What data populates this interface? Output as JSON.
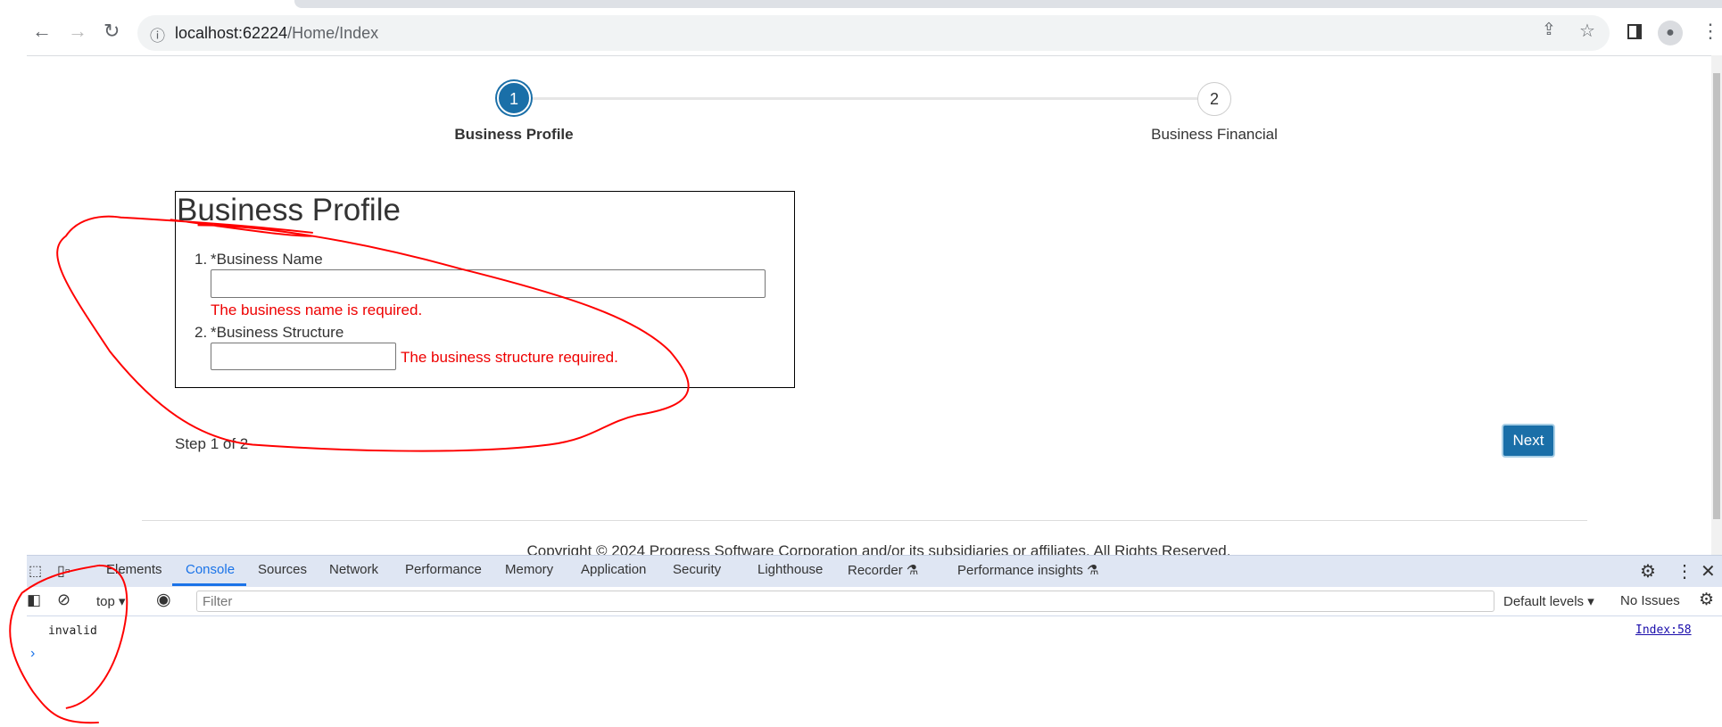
{
  "browser": {
    "url_host": "localhost:62224",
    "url_path": "/Home/Index"
  },
  "stepper": {
    "steps": [
      {
        "number": "1",
        "label": "Business Profile",
        "active": true
      },
      {
        "number": "2",
        "label": "Business Financial",
        "active": false
      }
    ]
  },
  "form": {
    "title": "Business Profile",
    "fields": [
      {
        "number": "1.",
        "label": "*Business Name",
        "value": "",
        "error": "The business name is required."
      },
      {
        "number": "2.",
        "label": "*Business Structure",
        "value": "",
        "error": "The business structure required."
      }
    ],
    "step_text": "Step 1 of 2",
    "next_label": "Next"
  },
  "footer": {
    "copyright": "Copyright © 2024 Progress Software Corporation and/or its subsidiaries or affiliates. All Rights Reserved."
  },
  "devtools": {
    "tabs": [
      "Elements",
      "Console",
      "Sources",
      "Network",
      "Performance",
      "Memory",
      "Application",
      "Security",
      "Lighthouse",
      "Recorder ⚗",
      "Performance insights ⚗"
    ],
    "active_tab": "Console",
    "context": "top",
    "filter_placeholder": "Filter",
    "levels": "Default levels",
    "issues": "No Issues",
    "log": [
      {
        "message": "invalid",
        "source": "Index:58"
      }
    ]
  },
  "colors": {
    "accent": "#1a6fa8",
    "error": "#ff0000",
    "annotation": "#ff0000"
  }
}
